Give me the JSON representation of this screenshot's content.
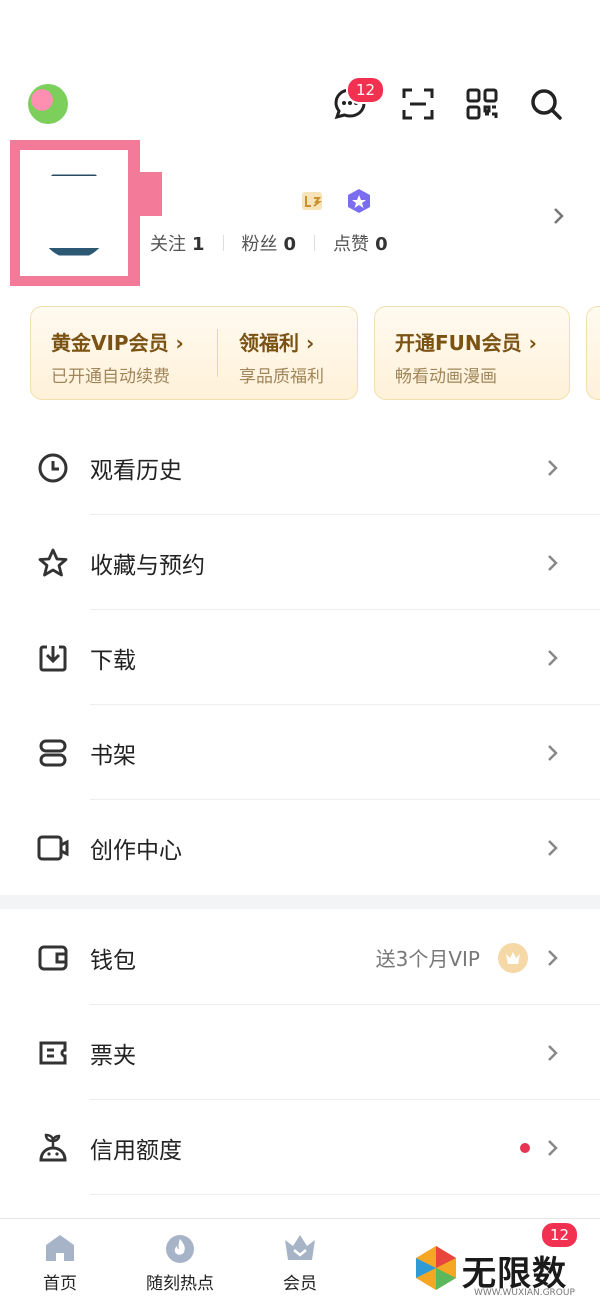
{
  "header": {
    "messages_badge": "12"
  },
  "profile": {
    "stats": [
      {
        "label": "关注",
        "value": "1"
      },
      {
        "label": "粉丝",
        "value": "0"
      },
      {
        "label": "点赞",
        "value": "0"
      }
    ]
  },
  "vip_cards": [
    {
      "title": "黄金VIP会员",
      "subtitle": "已开通自动续费"
    },
    {
      "title": "领福利",
      "subtitle": "享品质福利"
    },
    {
      "title": "开通FUN会员",
      "subtitle": "畅看动画漫画"
    }
  ],
  "menu": {
    "history": "观看历史",
    "favorites": "收藏与预约",
    "download": "下载",
    "bookshelf": "书架",
    "creator": "创作中心",
    "wallet": "钱包",
    "wallet_promo": "送3个月VIP",
    "tickets": "票夹",
    "credit": "信用额度"
  },
  "bottom_nav": {
    "home": "首页",
    "hot": "随刻热点",
    "member": "会员",
    "me_badge": "12"
  },
  "watermark": {
    "text": "无限数码",
    "sub": "WWW.WUXIAN.GROUP"
  },
  "colors": {
    "accent_badge": "#f2304f",
    "avatar_frame": "#f47a9a",
    "vip_text": "#7a5213"
  }
}
